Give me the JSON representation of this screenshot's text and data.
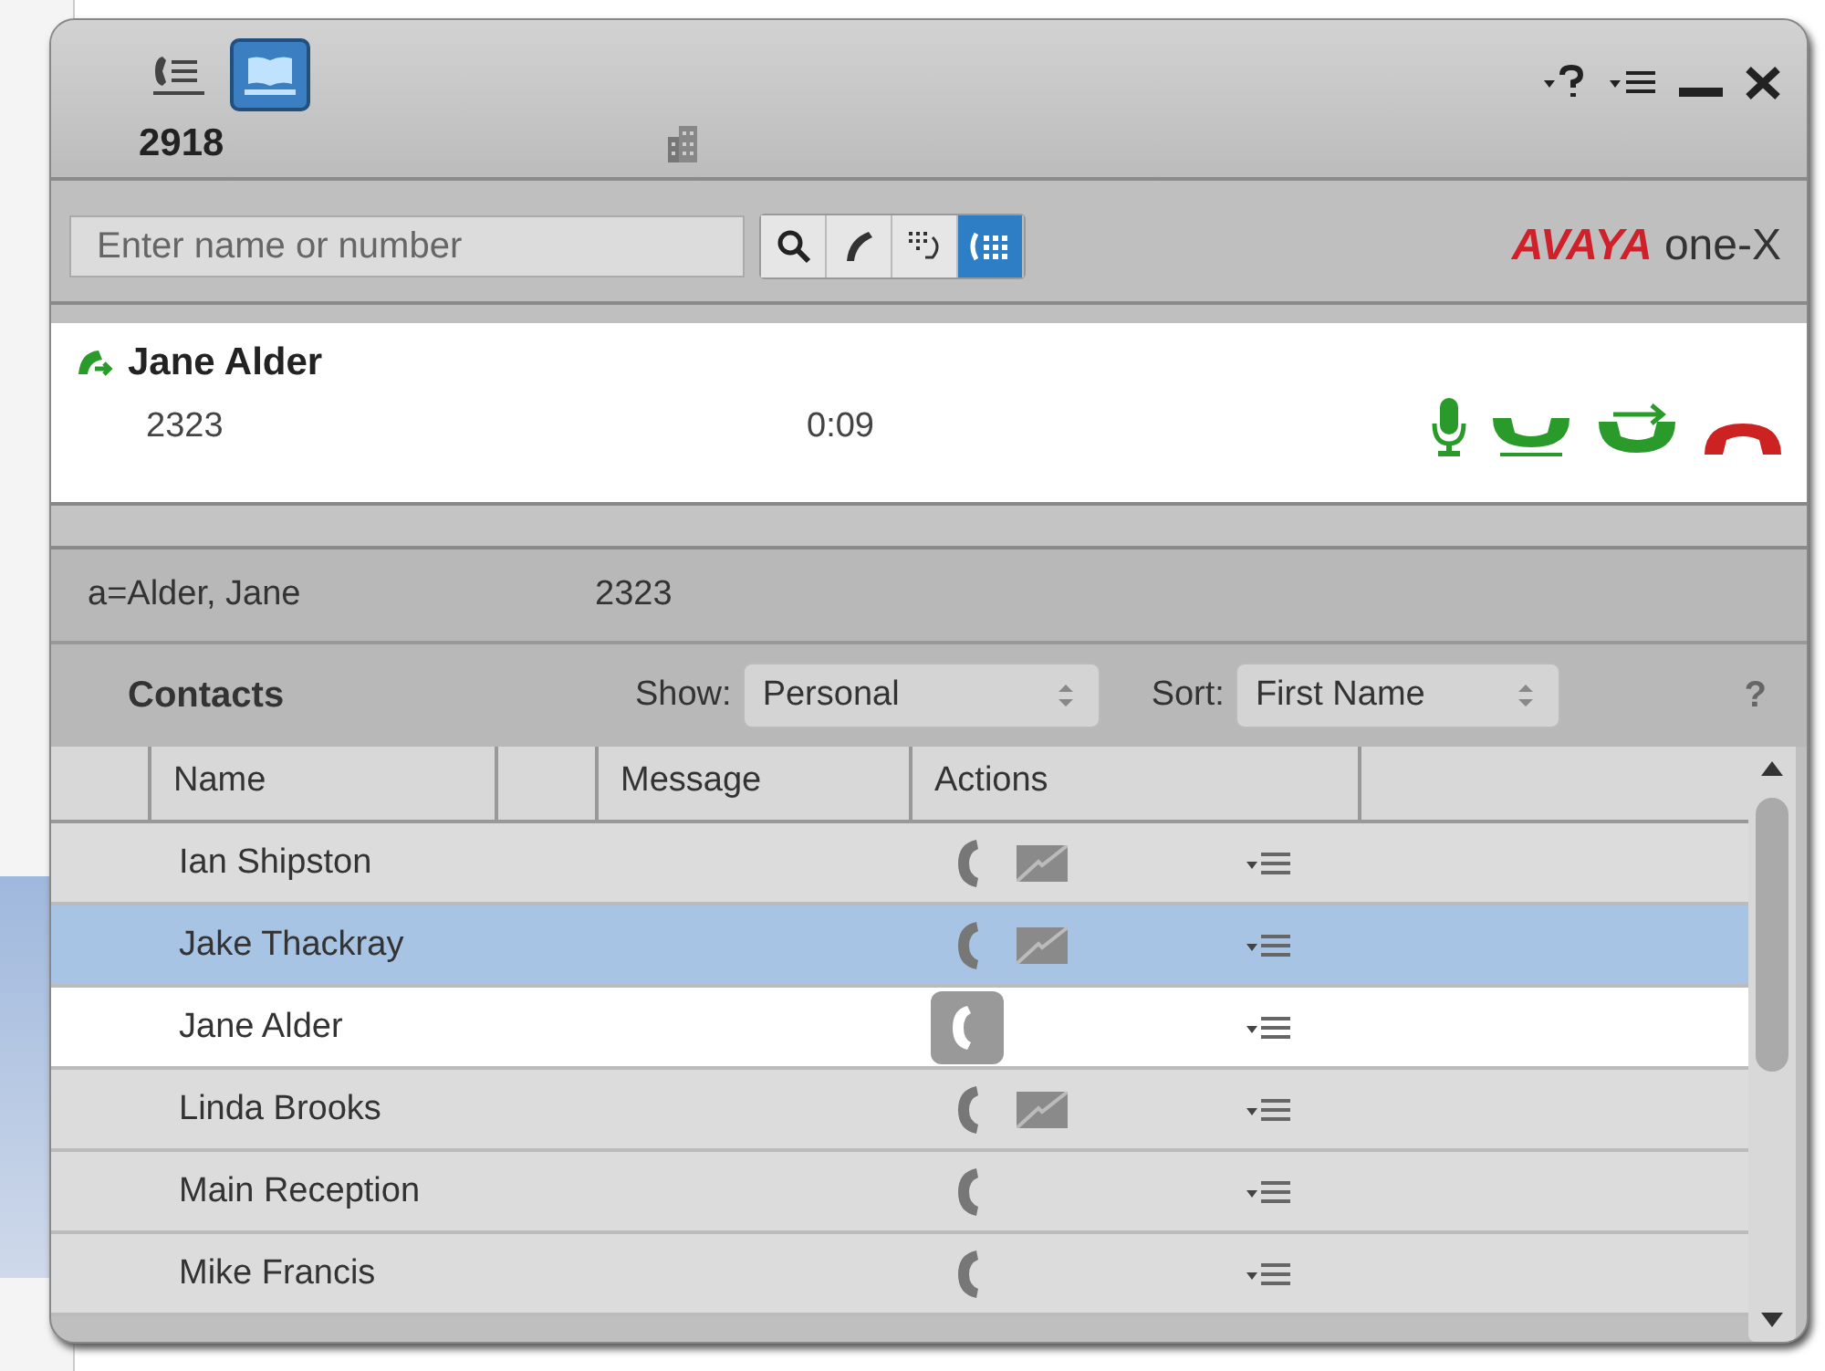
{
  "header": {
    "views": [
      {
        "kind": "call-log",
        "selected": false
      },
      {
        "kind": "contacts",
        "selected": true
      }
    ],
    "extension": "2918"
  },
  "search": {
    "placeholder": "Enter name or number",
    "modes": [
      {
        "kind": "search",
        "selected": false
      },
      {
        "kind": "call",
        "selected": false
      },
      {
        "kind": "redial",
        "selected": false
      },
      {
        "kind": "dialpad",
        "selected": true
      }
    ]
  },
  "logo": {
    "brand": "AVAYA",
    "product": "one-X"
  },
  "call": {
    "name": "Jane Alder",
    "number": "2323",
    "duration": "0:09"
  },
  "match": {
    "name": "a=Alder, Jane",
    "number": "2323"
  },
  "contacts": {
    "title": "Contacts",
    "show_label": "Show:",
    "show_value": "Personal",
    "sort_label": "Sort:",
    "sort_value": "First Name",
    "help": "?"
  },
  "table": {
    "columns": [
      "Name",
      "Message",
      "Actions"
    ],
    "rows": [
      {
        "name": "Ian Shipston",
        "selected": false,
        "active": false,
        "email": true
      },
      {
        "name": "Jake Thackray",
        "selected": true,
        "active": false,
        "email": true
      },
      {
        "name": "Jane Alder",
        "selected": false,
        "active": true,
        "email": false
      },
      {
        "name": "Linda Brooks",
        "selected": false,
        "active": false,
        "email": true
      },
      {
        "name": "Main Reception",
        "selected": false,
        "active": false,
        "email": false
      },
      {
        "name": "Mike Francis",
        "selected": false,
        "active": false,
        "email": false
      }
    ]
  }
}
